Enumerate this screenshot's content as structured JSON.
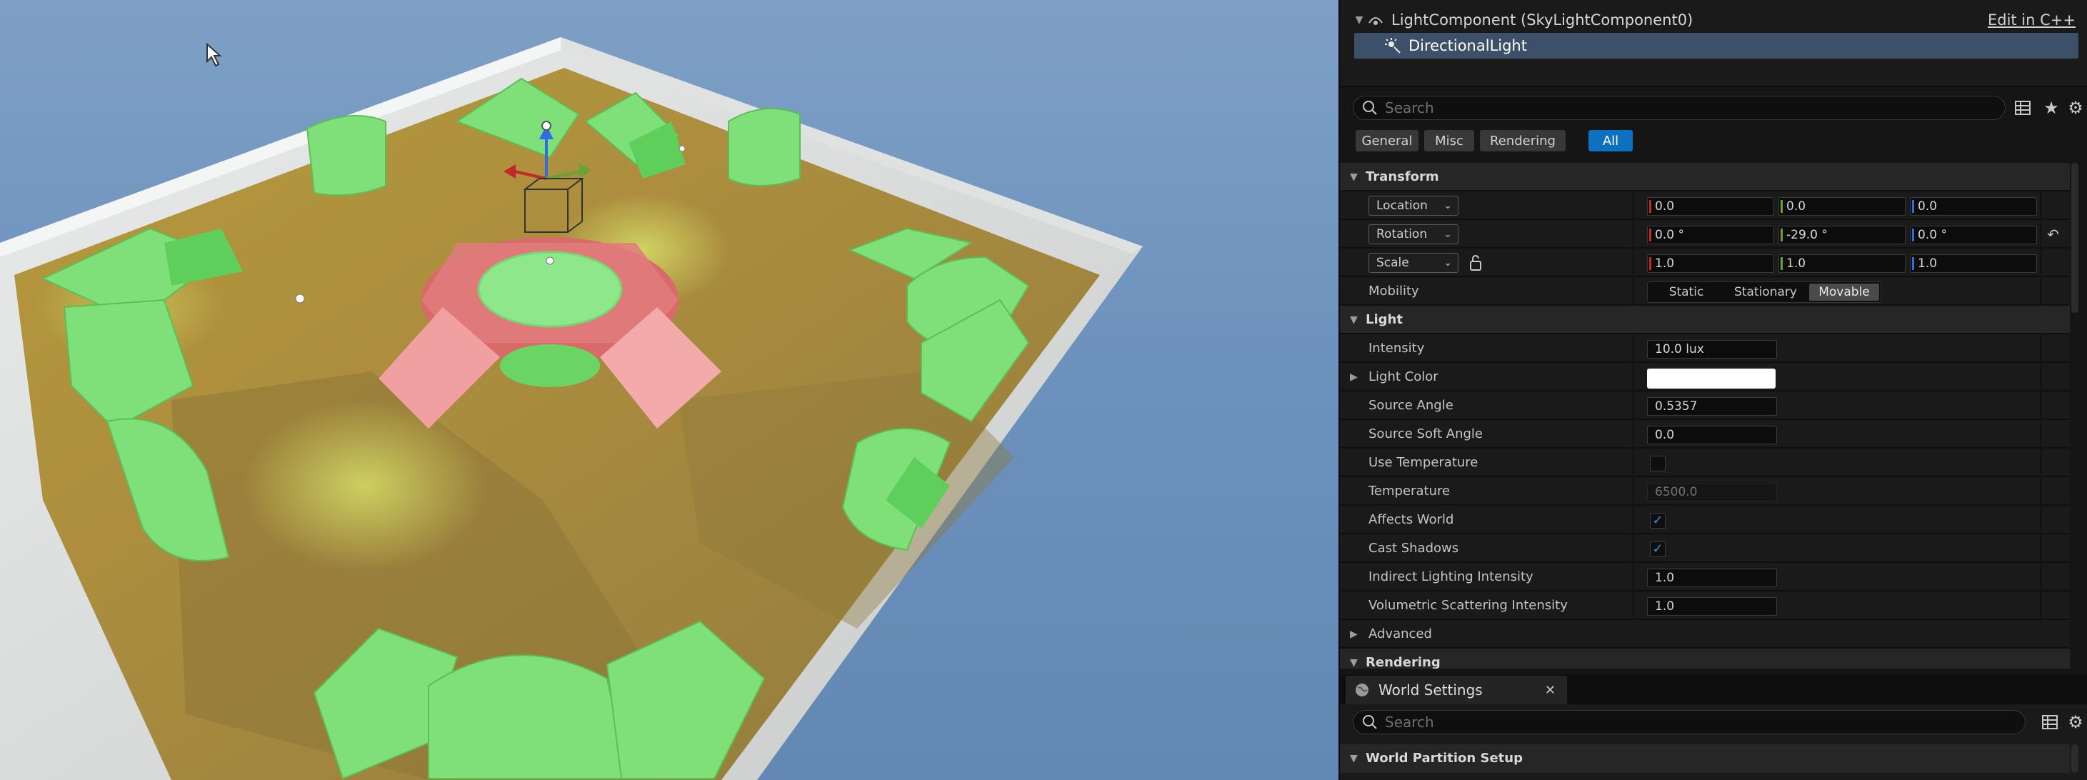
{
  "outliner": {
    "rows": [
      {
        "label": "LightComponent (SkyLightComponent0)",
        "action": "Edit in C++",
        "icon": "skylight-icon",
        "expanded": true
      },
      {
        "label": "DirectionalLight",
        "icon": "directional-light-icon",
        "selected": true
      }
    ]
  },
  "details": {
    "search_placeholder": "Search",
    "toolbar_icons": [
      "table-view-icon",
      "star-icon",
      "gear-icon"
    ],
    "filter_tabs": [
      "General",
      "Misc",
      "Rendering",
      "All"
    ],
    "active_filter": "All",
    "transform": {
      "title": "Transform",
      "location": {
        "mode": "Location",
        "x": "0.0",
        "y": "0.0",
        "z": "0.0"
      },
      "rotation": {
        "mode": "Rotation",
        "x": "0.0 °",
        "y": "-29.0 °",
        "z": "0.0 °"
      },
      "scale": {
        "mode": "Scale",
        "x": "1.0",
        "y": "1.0",
        "z": "1.0"
      },
      "mobility": {
        "label": "Mobility",
        "options": [
          "Static",
          "Stationary",
          "Movable"
        ],
        "selected": "Movable"
      }
    },
    "light": {
      "title": "Light",
      "intensity": {
        "label": "Intensity",
        "value": "10.0 lux"
      },
      "light_color": {
        "label": "Light Color",
        "value": "#ffffff"
      },
      "source_angle": {
        "label": "Source Angle",
        "value": "0.5357"
      },
      "source_soft_angle": {
        "label": "Source Soft Angle",
        "value": "0.0"
      },
      "use_temperature": {
        "label": "Use Temperature",
        "checked": false
      },
      "temperature": {
        "label": "Temperature",
        "value": "6500.0"
      },
      "affects_world": {
        "label": "Affects World",
        "checked": true
      },
      "cast_shadows": {
        "label": "Cast Shadows",
        "checked": true
      },
      "indirect_lighting_intensity": {
        "label": "Indirect Lighting Intensity",
        "value": "1.0"
      },
      "volumetric_scattering_intensity": {
        "label": "Volumetric Scattering Intensity",
        "value": "1.0"
      },
      "advanced": "Advanced"
    },
    "rendering_title": "Rendering"
  },
  "world_settings": {
    "tab_label": "World Settings",
    "search_placeholder": "Search",
    "first_section": "World Partition Setup"
  },
  "colors": {
    "accent": "#0e70c0",
    "axis_x": "#c4282b",
    "axis_y": "#6aa330",
    "axis_z": "#2f6ee0",
    "checkbox": "#2f8fe0"
  }
}
